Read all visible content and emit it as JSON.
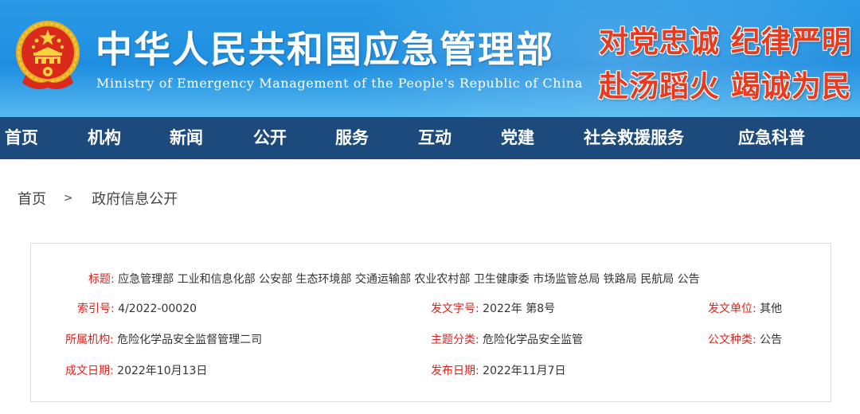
{
  "header": {
    "title": "中华人民共和国应急管理部",
    "subtitle": "Ministry of Emergency Management of the People's Republic of China",
    "slogan_line1": "对党忠诚 纪律严明",
    "slogan_line2": "赴汤蹈火 竭诚为民"
  },
  "nav": {
    "items": [
      "首页",
      "机构",
      "新闻",
      "公开",
      "服务",
      "互动",
      "党建",
      "社会救援服务",
      "应急科普"
    ]
  },
  "breadcrumb": {
    "home": "首页",
    "separator": ">",
    "current": "政府信息公开"
  },
  "info": {
    "title_label": "标题:",
    "title_value": "应急管理部 工业和信息化部 公安部 生态环境部 交通运输部 农业农村部 卫生健康委 市场监管总局 铁路局 民航局 公告",
    "index_label": "索引号:",
    "index_value": "4/2022-00020",
    "doc_no_label": "发文字号:",
    "doc_no_value": "2022年 第8号",
    "issuer_label": "发文单位:",
    "issuer_value": "其他",
    "org_label": "所属机构:",
    "org_value": "危险化学品安全监督管理二司",
    "topic_label": "主题分类:",
    "topic_value": "危险化学品安全监管",
    "doc_type_label": "公文种类:",
    "doc_type_value": "公告",
    "written_label": "成文日期:",
    "written_value": "2022年10月13日",
    "published_label": "发布日期:",
    "published_value": "2022年11月7日"
  },
  "colors": {
    "banner_blue": "#1f8ee0",
    "nav_blue": "#1d4a7d",
    "label_red": "#d8261f",
    "slogan_red": "#e83a1f"
  },
  "icons": {
    "emblem": "national-emblem-icon"
  }
}
